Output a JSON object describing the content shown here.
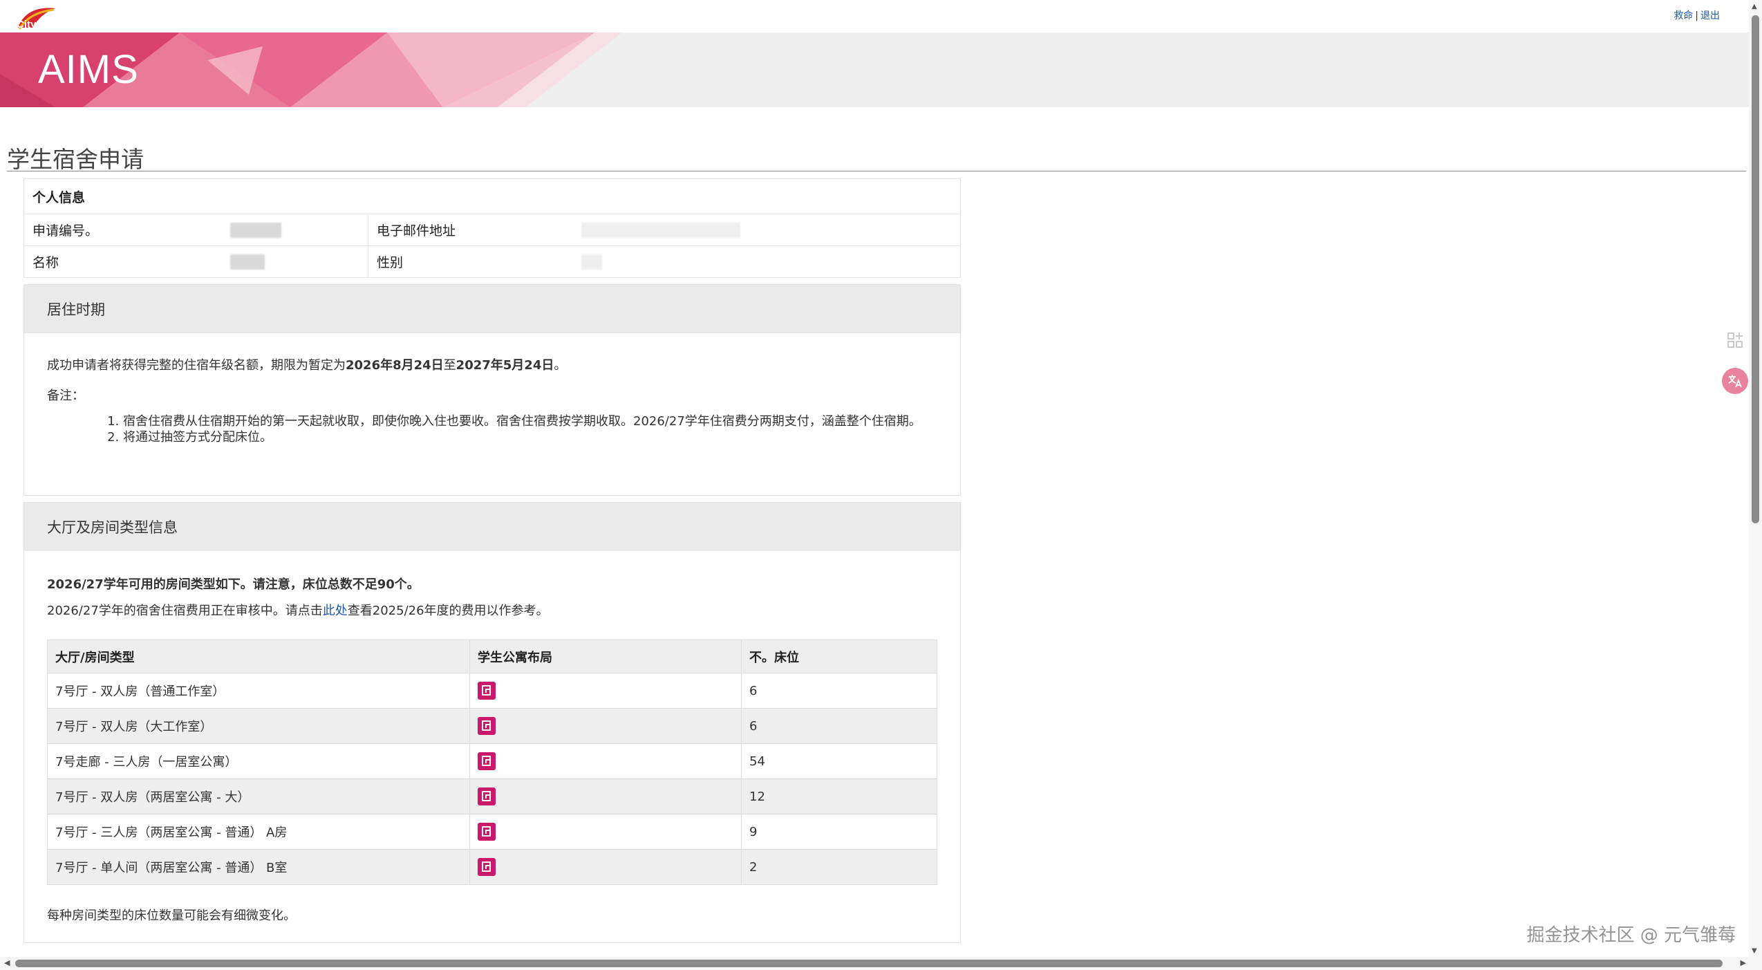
{
  "header": {
    "logo_text": "CityU",
    "links": {
      "help": "救命",
      "separator": "|",
      "logout": "退出"
    }
  },
  "banner": {
    "title": "AIMS"
  },
  "page": {
    "title": "学生宿舍申请"
  },
  "personal_info": {
    "heading": "个人信息",
    "application_no_label": "申请编号。",
    "email_label": "电子邮件地址",
    "name_label": "名称",
    "gender_label": "性别"
  },
  "residence": {
    "heading": "居住时期",
    "intro_prefix": "成功申请者将获得完整的住宿年级名额，期限为暂定为",
    "start_date": "2026年8月24日",
    "to": "至",
    "end_date": "2027年5月24日",
    "intro_suffix": "。",
    "notes_label": "备注：",
    "notes": [
      "宿舍住宿费从住宿期开始的第一天起就收取，即使你晚入住也要收。宿舍住宿费按学期收取。2026/27学年住宿费分两期支付，涵盖整个住宿期。",
      "将通过抽签方式分配床位。"
    ]
  },
  "hall": {
    "heading": "大厅及房间类型信息",
    "bold_notice": "2026/27学年可用的房间类型如下。请注意，床位总数不足90个。",
    "fee_prefix": "2026/27学年的宿舍住宿费用正在审核中。请点击",
    "fee_link": "此处",
    "fee_suffix": "查看2025/26年度的费用以作参考。",
    "columns": [
      "大厅/房间类型",
      "学生公寓布局",
      "不。床位"
    ],
    "rows": [
      {
        "type": "7号厅 - 双人房（普通工作室）",
        "beds": "6"
      },
      {
        "type": "7号厅 - 双人房（大工作室）",
        "beds": "6"
      },
      {
        "type": "7号走廊 - 三人房（一居室公寓）",
        "beds": "54"
      },
      {
        "type": "7号厅 - 双人房（两居室公寓 - 大）",
        "beds": "12"
      },
      {
        "type": "7号厅 - 三人房（两居室公寓 - 普通） A房",
        "beds": "9"
      },
      {
        "type": "7号厅 - 单人间（两居室公寓 - 普通） B室",
        "beds": "2"
      }
    ],
    "footer_note": "每种房间类型的床位数量可能会有细微变化。"
  },
  "watermark": "掘金技术社区 @ 元气雏莓",
  "colors": {
    "accent": "#c8196b",
    "link": "#1a5aa8",
    "banner_pink": "#e2557f"
  },
  "icons": {
    "layout": "document-icon",
    "apps": "apps-icon",
    "translate": "translate-icon"
  }
}
